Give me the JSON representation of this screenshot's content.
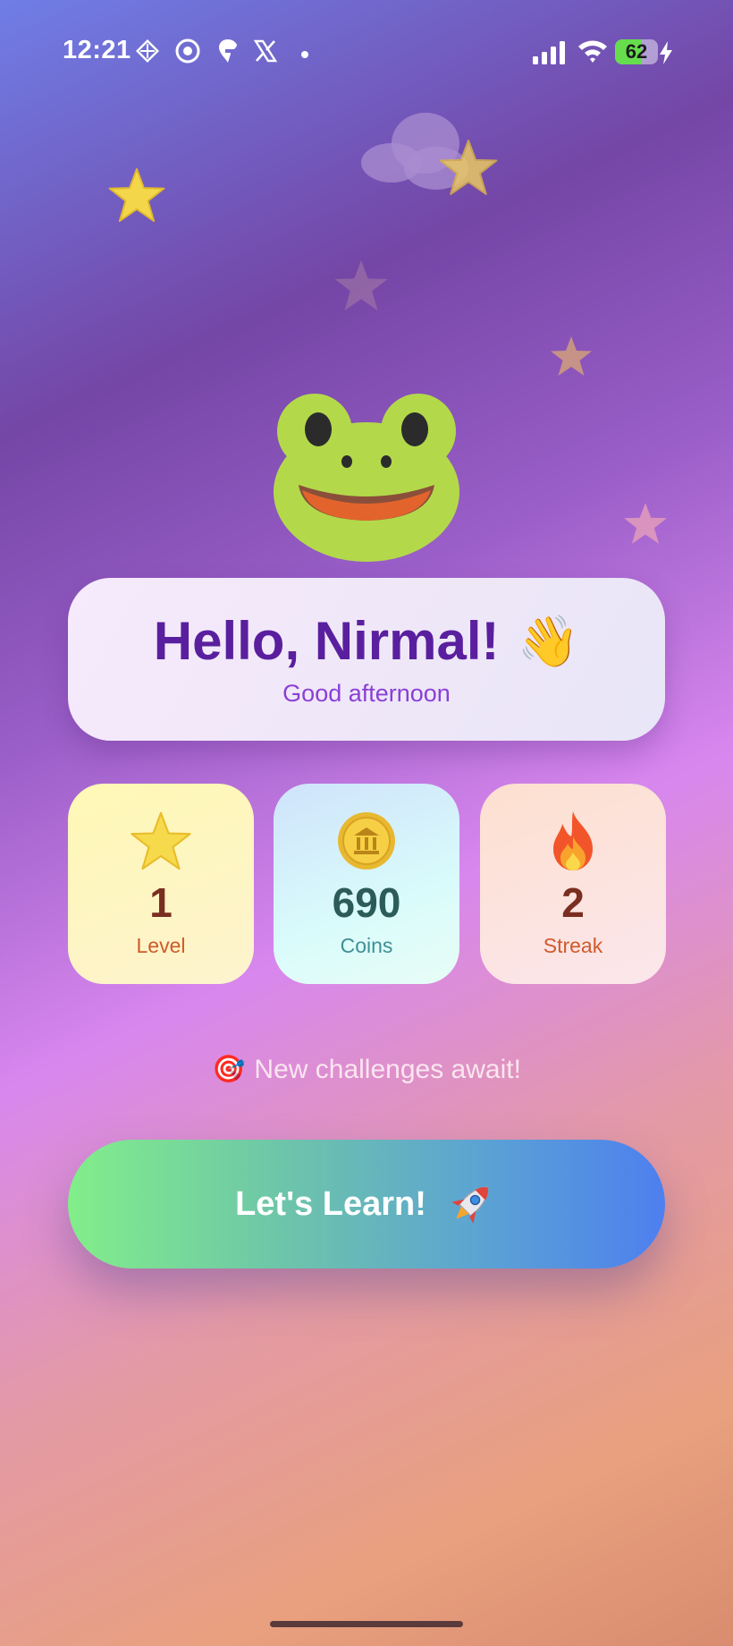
{
  "status_bar": {
    "time": "12:21",
    "notification_icons": [
      "diamond-grid-icon",
      "shutter-icon",
      "swiggy-icon",
      "x-logo-icon",
      "dot-icon"
    ],
    "battery_percent": "62",
    "battery_level": 0.62,
    "charging": true
  },
  "greeting": {
    "title": "Hello, Nirmal!",
    "emoji": "👋",
    "subtitle": "Good afternoon"
  },
  "stats": [
    {
      "icon": "star-icon",
      "value": "1",
      "label": "Level",
      "value_color": "#7a2e20",
      "label_color": "#cf5a2a"
    },
    {
      "icon": "coin-icon",
      "value": "690",
      "label": "Coins",
      "value_color": "#2c5b5a",
      "label_color": "#3f8f94"
    },
    {
      "icon": "fire-icon",
      "value": "2",
      "label": "Streak",
      "value_color": "#7a2e20",
      "label_color": "#cf5a2a"
    }
  ],
  "challenge": {
    "emoji": "🎯",
    "text": "New challenges await!"
  },
  "cta": {
    "label": "Let's Learn!",
    "icon": "rocket-icon"
  },
  "colors": {
    "greeting_title": "#5a1f9e",
    "greeting_subtitle": "#8a3fd6",
    "frog_green": "#b3d94a"
  }
}
